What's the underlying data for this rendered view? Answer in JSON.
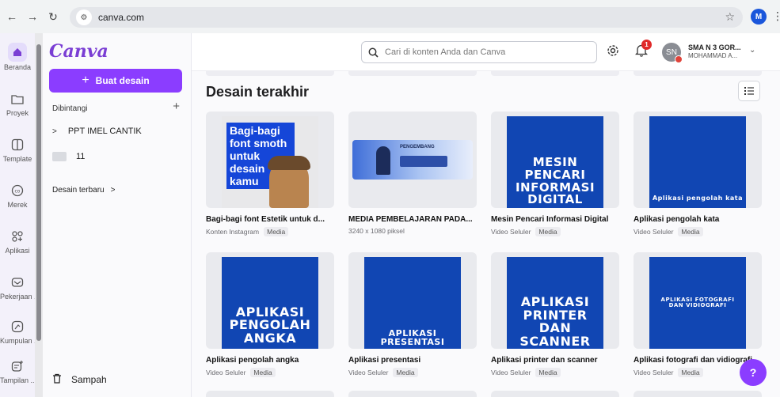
{
  "browser": {
    "url": "canva.com",
    "profile_initial": "M"
  },
  "rail": {
    "items": [
      {
        "label": "Beranda",
        "icon": "home-icon"
      },
      {
        "label": "Proyek",
        "icon": "folder-icon"
      },
      {
        "label": "Template",
        "icon": "template-icon"
      },
      {
        "label": "Merek",
        "icon": "brand-icon"
      },
      {
        "label": "Aplikasi",
        "icon": "apps-icon"
      },
      {
        "label": "Pekerjaan ...",
        "icon": "work-icon"
      },
      {
        "label": "Kumpulan ...",
        "icon": "magic-icon"
      },
      {
        "label": "Tampilan ...",
        "icon": "sparkle-icon"
      }
    ]
  },
  "panel": {
    "logo": "Canva",
    "create_label": "Buat desain",
    "starred_label": "Dibintangi",
    "items": [
      {
        "label": "PPT IMEL CANTIK",
        "type": "folder-tree"
      },
      {
        "label": "11",
        "type": "folder"
      }
    ],
    "recent_label": "Desain terbaru",
    "trash_label": "Sampah"
  },
  "topbar": {
    "search_placeholder": "Cari di konten Anda dan Canva",
    "notif_count": "1",
    "avatar_initials": "SN",
    "account_name": "SMA N 3 GOR...",
    "account_sub": "MOHAMMAD A..."
  },
  "main": {
    "heading": "Desain terakhir",
    "designs": [
      {
        "title": "Bagi-bagi font Estetik untuk d...",
        "meta": "Konten Instagram",
        "tag": "Media",
        "thumb_text": "Bagi-bagi font smoth untuk desain kamu"
      },
      {
        "title": "MEDIA PEMBELAJARAN PADA...",
        "meta": "3240 x 1080 piksel",
        "tag": "",
        "thumb_text": "PENGEMBANG"
      },
      {
        "title": "Mesin Pencari Informasi Digital",
        "meta": "Video Seluler",
        "tag": "Media",
        "thumb_text": "MESIN PENCARI INFORMASI DIGITAL"
      },
      {
        "title": "Aplikasi pengolah kata",
        "meta": "Video Seluler",
        "tag": "Media",
        "thumb_text": "Aplikasi pengolah kata"
      },
      {
        "title": "Aplikasi pengolah angka",
        "meta": "Video Seluler",
        "tag": "Media",
        "thumb_text": "APLIKASI PENGOLAH ANGKA"
      },
      {
        "title": "Aplikasi presentasi",
        "meta": "Video Seluler",
        "tag": "Media",
        "thumb_text": "APLIKASI PRESENTASI"
      },
      {
        "title": "Aplikasi printer dan scanner",
        "meta": "Video Seluler",
        "tag": "Media",
        "thumb_text": "APLIKASI PRINTER DAN SCANNER"
      },
      {
        "title": "Aplikasi fotografi dan vidiografi",
        "meta": "Video Seluler",
        "tag": "Media",
        "thumb_text": "APLIKASI FOTOGRAFI DAN VIDIOGRAFI"
      }
    ]
  },
  "help_label": "?",
  "colors": {
    "accent": "#8b3dff",
    "slide_blue": "#1146b3"
  }
}
